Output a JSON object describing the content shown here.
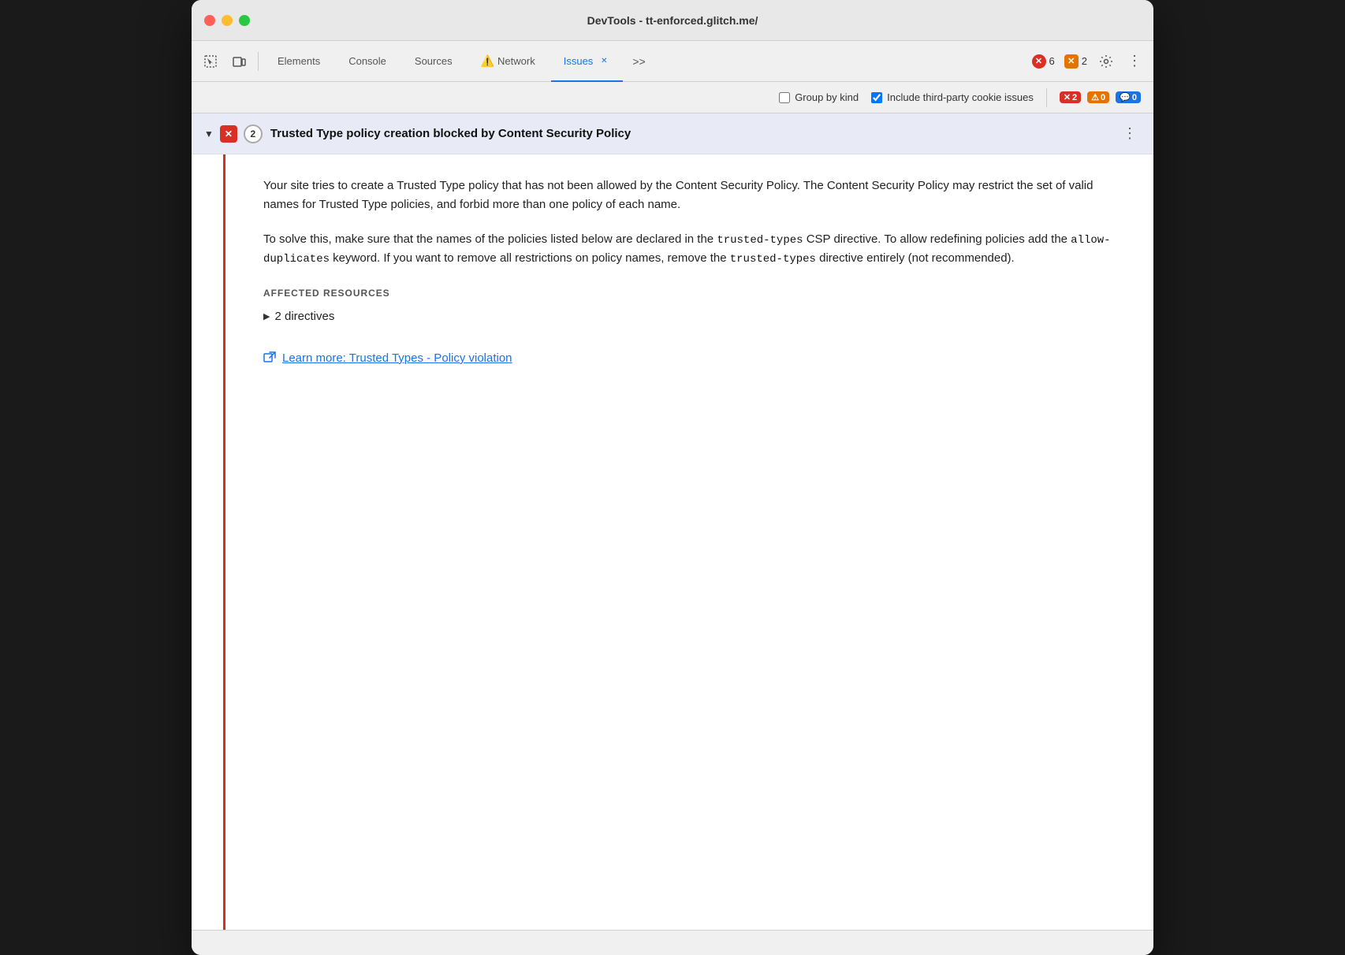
{
  "window": {
    "title": "DevTools - tt-enforced.glitch.me/"
  },
  "toolbar": {
    "tabs": [
      {
        "id": "elements",
        "label": "Elements",
        "active": false,
        "hasWarning": false,
        "closeable": false
      },
      {
        "id": "console",
        "label": "Console",
        "active": false,
        "hasWarning": false,
        "closeable": false
      },
      {
        "id": "sources",
        "label": "Sources",
        "active": false,
        "hasWarning": false,
        "closeable": false
      },
      {
        "id": "network",
        "label": "Network",
        "active": false,
        "hasWarning": true,
        "closeable": false
      },
      {
        "id": "issues",
        "label": "Issues",
        "active": true,
        "hasWarning": false,
        "closeable": true
      }
    ],
    "more_label": ">>",
    "error_count": "6",
    "warning_count": "2"
  },
  "secondary_toolbar": {
    "group_by_kind_label": "Group by kind",
    "group_by_kind_checked": false,
    "include_third_party_label": "Include third-party cookie issues",
    "include_third_party_checked": true,
    "error_badge_count": "2",
    "warning_badge_count": "0",
    "info_badge_count": "0"
  },
  "issue": {
    "count": "2",
    "title": "Trusted Type policy creation blocked by Content Security Policy",
    "description_p1": "Your site tries to create a Trusted Type policy that has not been allowed by the Content Security Policy. The Content Security Policy may restrict the set of valid names for Trusted Type policies, and forbid more than one policy of each name.",
    "description_p2_prefix": "To solve this, make sure that the names of the policies listed below are declared in the ",
    "code1": "trusted-types",
    "description_p2_mid1": " CSP directive. To allow redefining policies add the ",
    "code2": "allow-\nduplicates",
    "description_p2_mid2": " keyword. If you want to remove all restrictions on policy names, remove the ",
    "code3": "trusted-types",
    "description_p2_suffix": " directive entirely (not recommended).",
    "affected_resources_label": "AFFECTED RESOURCES",
    "directive_count": "2 directives",
    "learn_more_label": "Learn more: Trusted Types - Policy violation"
  }
}
